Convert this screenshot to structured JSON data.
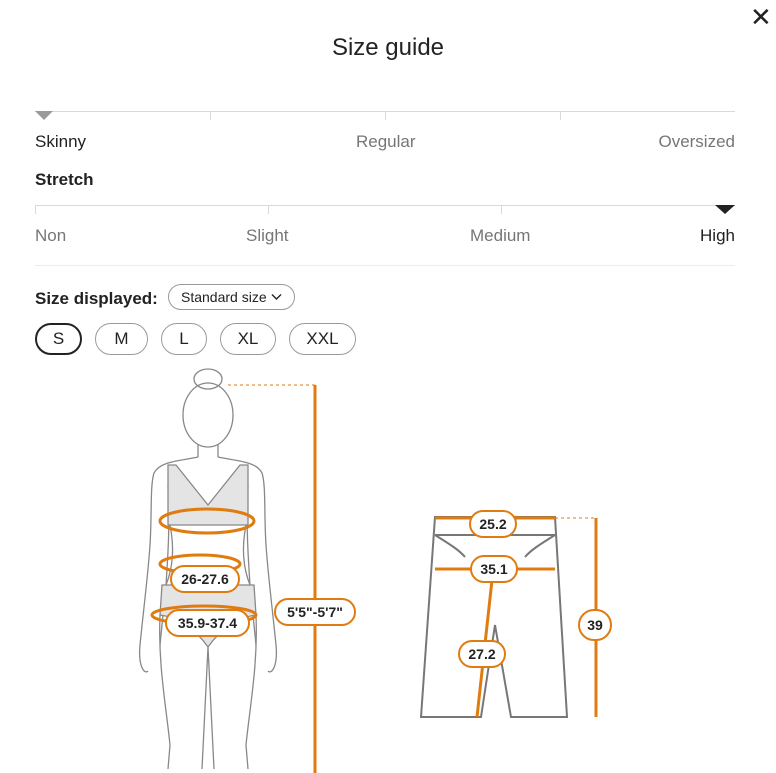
{
  "modal": {
    "title": "Size guide"
  },
  "fit_scale": {
    "labels": [
      "Skinny",
      "Regular",
      "Oversized"
    ],
    "selected": "Skinny"
  },
  "stretch": {
    "title": "Stretch",
    "labels": [
      "Non",
      "Slight",
      "Medium",
      "High"
    ],
    "selected": "High"
  },
  "size_display": {
    "label": "Size displayed:",
    "dropdown_value": "Standard size"
  },
  "sizes": {
    "options": [
      "S",
      "M",
      "L",
      "XL",
      "XXL"
    ],
    "selected": "S"
  },
  "body_measurements": {
    "bust_label": "",
    "waist": "26-27.6",
    "hips": "35.9-37.4",
    "height": "5'5\"-5'7\""
  },
  "garment_measurements": {
    "waist": "25.2",
    "hips": "35.1",
    "inseam": "27.2",
    "length": "39"
  },
  "colors": {
    "accent": "#e07b10",
    "text": "#222222",
    "muted": "#767676",
    "line": "#d9d9d9"
  },
  "icons": {
    "close": "close-icon",
    "fit_marker": "triangle-marker-icon",
    "dropdown": "chevron-down-icon"
  }
}
